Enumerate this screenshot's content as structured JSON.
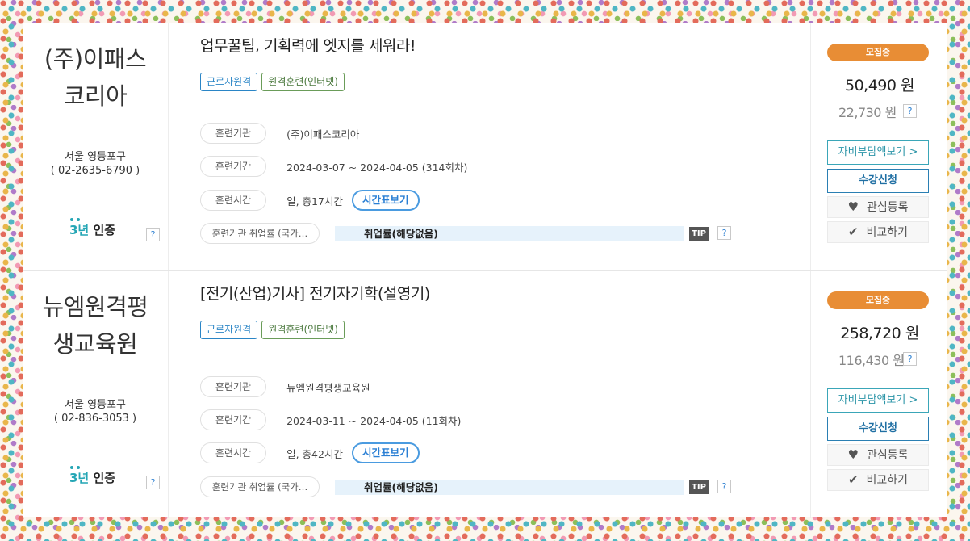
{
  "courses": [
    {
      "org_name": "(주)이패스 코리아",
      "org_location": "서울 영등포구",
      "org_phone": "( 02-2635-6790 )",
      "cert_num": "3년",
      "cert_label": "인증",
      "title": "업무꿀팁, 기획력에 엣지를 세워라!",
      "tag_worker": "근로자원격",
      "tag_type": "원격훈련(인터넷)",
      "label_institution": "훈련기관",
      "institution": "(주)이패스코리아",
      "label_period": "훈련기간",
      "period": "2024-03-07 ~ 2024-04-05 (314회차)",
      "label_time": "훈련시간",
      "time": "일, 총17시간",
      "timetable_label": "시간표보기",
      "label_rate": "훈련기관 취업률 (국가…",
      "rate": "취업률(해당없음)",
      "tip": "TIP",
      "status": "모집중",
      "price": "50,490 원",
      "self_price": "22,730 원",
      "fee_button": "자비부담액보기 >",
      "apply_button": "수강신청",
      "wish_button": "관심등록",
      "compare_button": "비교하기"
    },
    {
      "org_name": "뉴엠원격평 생교육원",
      "org_location": "서울 영등포구",
      "org_phone": "( 02-836-3053 )",
      "cert_num": "3년",
      "cert_label": "인증",
      "title": "[전기(산업)기사] 전기자기학(설영기)",
      "tag_worker": "근로자원격",
      "tag_type": "원격훈련(인터넷)",
      "label_institution": "훈련기관",
      "institution": "뉴엠원격평생교육원",
      "label_period": "훈련기간",
      "period": "2024-03-11 ~ 2024-04-05 (11회차)",
      "label_time": "훈련시간",
      "time": "일, 총42시간",
      "timetable_label": "시간표보기",
      "label_rate": "훈련기관 취업률 (국가…",
      "rate": "취업률(해당없음)",
      "tip": "TIP",
      "status": "모집중",
      "price": "258,720 원",
      "self_price": "116,430 원",
      "fee_button": "자비부담액보기 >",
      "apply_button": "수강신청",
      "wish_button": "관심등록",
      "compare_button": "비교하기"
    }
  ],
  "icons": {
    "help": "?",
    "wish": "heart-icon",
    "compare": "check-icon"
  },
  "colors": {
    "accent_orange": "#e88d35",
    "accent_teal": "#25a6b5",
    "accent_blue": "#2a85c6"
  }
}
